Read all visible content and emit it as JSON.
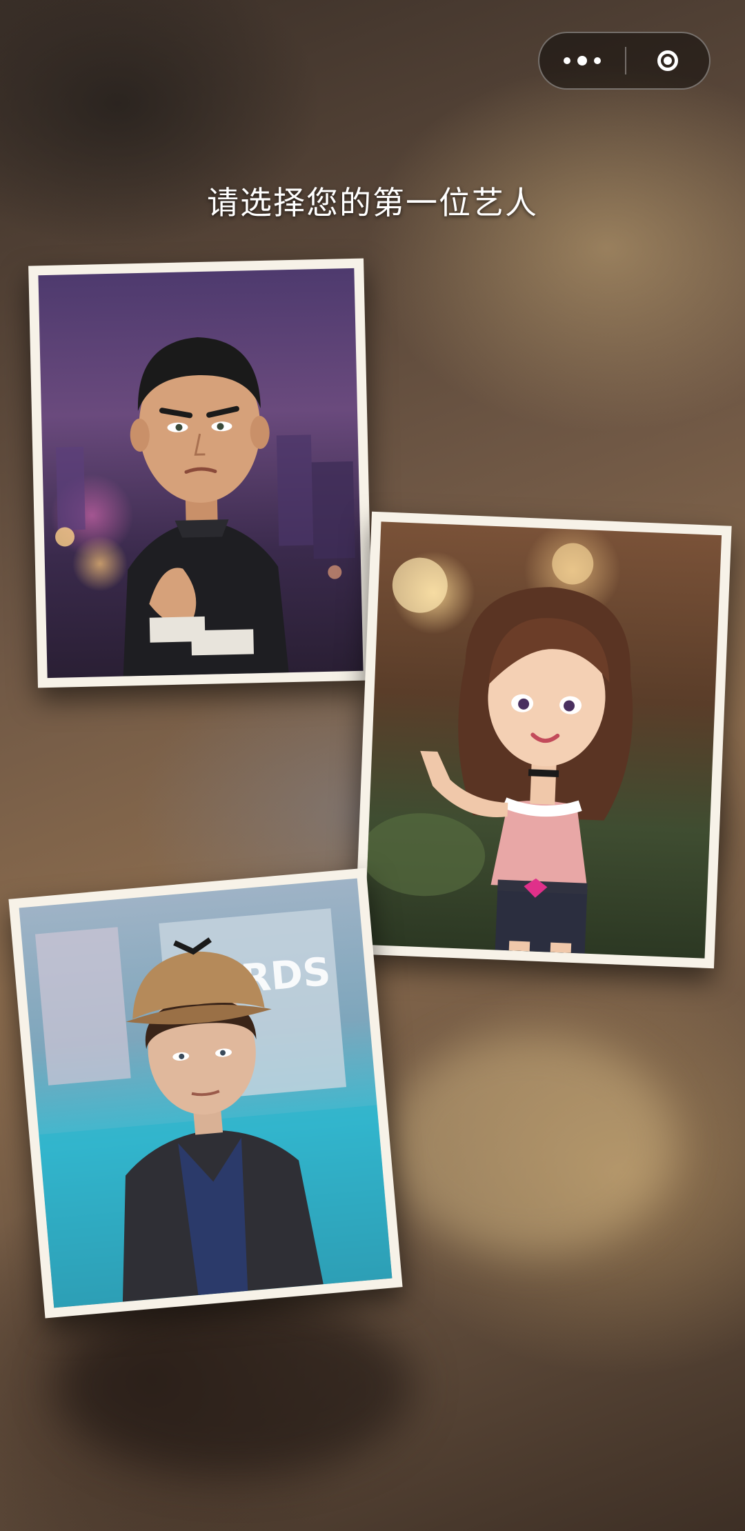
{
  "header": {
    "title": "请选择您的第一位艺人"
  },
  "capsule": {
    "more_icon": "more-dots-icon",
    "close_icon": "target-circle-icon"
  },
  "artists": [
    {
      "id": "artist-1",
      "portrait": "kungfu-master-portrait"
    },
    {
      "id": "artist-2",
      "portrait": "brunette-girl-portrait"
    },
    {
      "id": "artist-3",
      "portrait": "detective-portrait"
    }
  ],
  "scenery": {
    "sign_text": "WRDS"
  }
}
